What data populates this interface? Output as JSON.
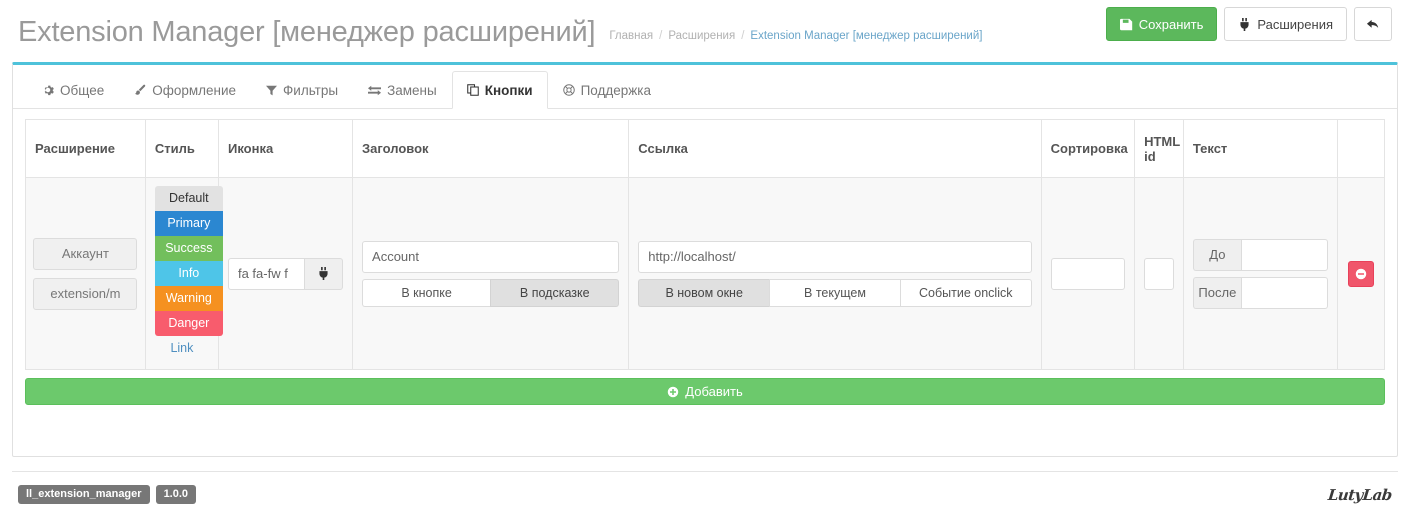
{
  "header": {
    "title": "Extension Manager [менеджер расширений]",
    "breadcrumb": [
      {
        "label": "Главная",
        "active": false
      },
      {
        "label": "Расширения",
        "active": false
      },
      {
        "label": "Extension Manager [менеджер расширений]",
        "active": true
      }
    ],
    "separator": "/",
    "actions": {
      "save_label": "Сохранить",
      "save_icon": "floppy-disk-icon",
      "extensions_label": "Расширения",
      "extensions_icon": "plug-icon",
      "back_icon": "undo-arrow-icon"
    }
  },
  "tabs": [
    {
      "label": "Общее",
      "icon": "gear-icon",
      "active": false
    },
    {
      "label": "Оформление",
      "icon": "brush-icon",
      "active": false
    },
    {
      "label": "Фильтры",
      "icon": "filter-icon",
      "active": false
    },
    {
      "label": "Замены",
      "icon": "exchange-icon",
      "active": false
    },
    {
      "label": "Кнопки",
      "icon": "copy-icon",
      "active": true
    },
    {
      "label": "Поддержка",
      "icon": "life-ring-icon",
      "active": false
    }
  ],
  "table": {
    "headers": {
      "extension": "Расширение",
      "style": "Стиль",
      "icon": "Иконка",
      "caption": "Заголовок",
      "link": "Ссылка",
      "sort": "Сортировка",
      "html_id": "HTML id",
      "text": "Текст",
      "actions": ""
    },
    "row": {
      "extension": {
        "name_value": "Аккаунт",
        "path_value": "extension/m",
        "name_placeholder": "",
        "path_placeholder": ""
      },
      "style": {
        "options": [
          {
            "label": "Default",
            "color": "#e2e2e2",
            "text_color": "#333333",
            "selected": true
          },
          {
            "label": "Primary",
            "color": "#2b87d1",
            "text_color": "#ffffff",
            "selected": false
          },
          {
            "label": "Success",
            "color": "#72bf5c",
            "text_color": "#ffffff",
            "selected": false
          },
          {
            "label": "Info",
            "color": "#4ec5e8",
            "text_color": "#ffffff",
            "selected": false
          },
          {
            "label": "Warning",
            "color": "#f59120",
            "text_color": "#ffffff",
            "selected": false
          },
          {
            "label": "Danger",
            "color": "#f85c6d",
            "text_color": "#ffffff",
            "selected": false
          }
        ],
        "link_label": "Link",
        "link_color": "#4f8fc0"
      },
      "icon": {
        "value": "fa fa-fw f",
        "placeholder": "",
        "addon_icon": "plug-icon"
      },
      "caption": {
        "value": "Account",
        "placeholder": "",
        "toggle": [
          {
            "label": "В кнопке",
            "active": false
          },
          {
            "label": "В подсказке",
            "active": true
          }
        ]
      },
      "link": {
        "value": "http://localhost/",
        "placeholder": "",
        "toggle": [
          {
            "label": "В новом окне",
            "active": true
          },
          {
            "label": "В текущем",
            "active": false
          },
          {
            "label": "Событие onclick",
            "active": false
          }
        ]
      },
      "sort": {
        "value": "",
        "placeholder": ""
      },
      "html_id": {
        "value": "",
        "placeholder": ""
      },
      "text": {
        "before_label": "До",
        "before_value": "",
        "after_label": "После",
        "after_value": ""
      },
      "delete_icon": "minus-circle-icon"
    }
  },
  "add_button": {
    "label": "Добавить",
    "icon": "plus-circle-icon",
    "color": "#6cc96c"
  },
  "footer": {
    "badges": [
      {
        "label": "ll_extension_manager"
      },
      {
        "label": "1.0.0"
      }
    ],
    "logo_text": "LutyLab"
  },
  "theme": {
    "accent": "#4ec2da",
    "success": "#5cb85c",
    "danger": "#f0566b",
    "link": "#6aa5c9"
  }
}
